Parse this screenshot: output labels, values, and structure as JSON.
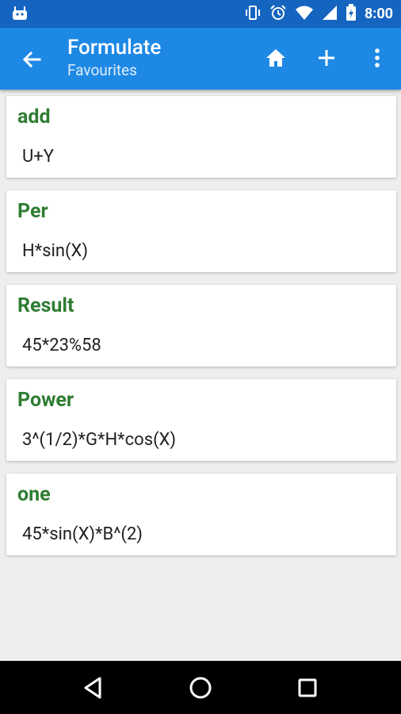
{
  "status": {
    "time": "8:00",
    "icons": [
      "android-debug-icon",
      "vibrate-icon",
      "alarm-icon",
      "wifi-icon",
      "signal-icon",
      "battery-icon"
    ]
  },
  "appbar": {
    "title": "Formulate",
    "subtitle": "Favourites",
    "icons": [
      "back-arrow-icon",
      "home-icon",
      "add-icon",
      "more-vert-icon"
    ],
    "color": "#1e88e5"
  },
  "formulas": [
    {
      "name": "add",
      "formula": "U+Y"
    },
    {
      "name": "Per",
      "formula": "H*sin(X)"
    },
    {
      "name": "Result",
      "formula": "45*23%58"
    },
    {
      "name": "Power",
      "formula": "3^(1/2)*G*H*cos(X)"
    },
    {
      "name": "one",
      "formula": "45*sin(X)*B^(2)"
    }
  ],
  "navbar": {
    "icons": [
      "back-icon",
      "home-circle-icon",
      "recents-icon"
    ]
  },
  "colors": {
    "accent_name": "#2e7d32",
    "statusbar": "#1565c0",
    "background": "#eeeeee"
  }
}
